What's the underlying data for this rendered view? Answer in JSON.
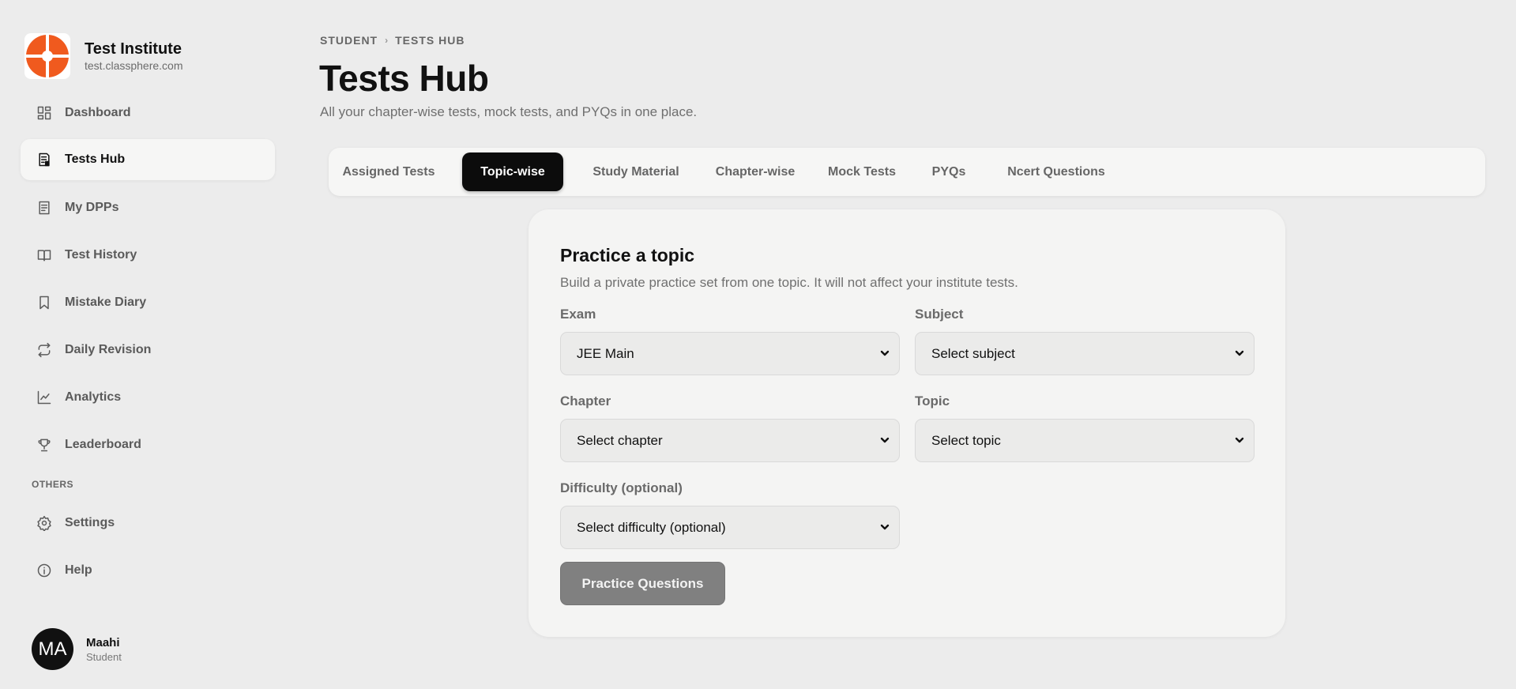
{
  "brand": {
    "name": "Test Institute",
    "domain": "test.classphere.com",
    "logo_color": "#f05a1e"
  },
  "sidebar": {
    "items": [
      {
        "label": "Dashboard",
        "icon": "dashboard-icon"
      },
      {
        "label": "Tests Hub",
        "icon": "tests-hub-icon",
        "active": true
      },
      {
        "label": "My DPPs",
        "icon": "document-icon"
      },
      {
        "label": "Test History",
        "icon": "book-open-icon"
      },
      {
        "label": "Mistake Diary",
        "icon": "bookmark-icon"
      },
      {
        "label": "Daily Revision",
        "icon": "repeat-icon"
      },
      {
        "label": "Analytics",
        "icon": "line-chart-icon"
      },
      {
        "label": "Leaderboard",
        "icon": "trophy-icon"
      }
    ],
    "section_label": "OTHERS",
    "other_items": [
      {
        "label": "Settings",
        "icon": "gear-icon"
      },
      {
        "label": "Help",
        "icon": "info-icon"
      }
    ]
  },
  "user": {
    "initials": "MA",
    "name": "Maahi",
    "role": "Student"
  },
  "header": {
    "breadcrumb": [
      "STUDENT",
      "TESTS HUB"
    ],
    "title": "Tests Hub",
    "subtitle": "All your chapter-wise tests, mock tests, and PYQs in one place."
  },
  "tabs": [
    {
      "label": "Assigned Tests"
    },
    {
      "label": "Topic-wise",
      "active": true
    },
    {
      "label": "Study Material"
    },
    {
      "label": "Chapter-wise"
    },
    {
      "label": "Mock Tests"
    },
    {
      "label": "PYQs"
    },
    {
      "label": "Ncert Questions"
    }
  ],
  "practice": {
    "title": "Practice a topic",
    "description": "Build a private practice set from one topic. It will not affect your institute tests.",
    "fields": {
      "exam": {
        "label": "Exam",
        "value": "JEE Main"
      },
      "subject": {
        "label": "Subject",
        "value": "Select subject"
      },
      "chapter": {
        "label": "Chapter",
        "value": "Select chapter"
      },
      "topic": {
        "label": "Topic",
        "value": "Select topic"
      },
      "difficulty": {
        "label": "Difficulty (optional)",
        "value": "Select difficulty (optional)"
      }
    },
    "button_label": "Practice Questions"
  }
}
